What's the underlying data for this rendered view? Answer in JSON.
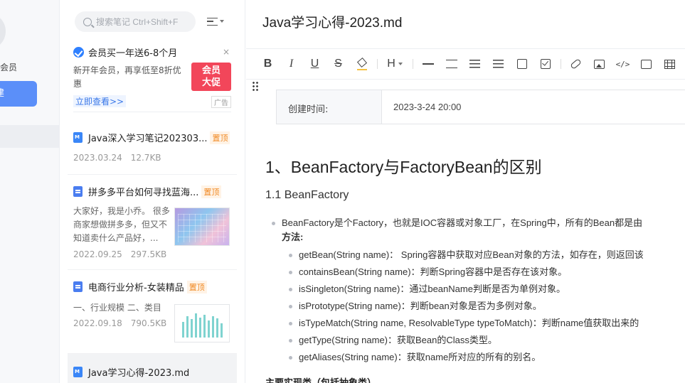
{
  "sidebar": {
    "member_label": "会员",
    "new_button_label": "建"
  },
  "search": {
    "placeholder": "搜索笔记 Ctrl+Shift+F"
  },
  "ad": {
    "title": "会员买一年送6-8个月",
    "close": "×",
    "desc": "新开年会员，再享低至8折优惠",
    "image_text": "会员\n大促",
    "link": "立即查看>>",
    "tag": "广告"
  },
  "notes": [
    {
      "icon": "md-file-icon",
      "title": "Java深入学习笔记202303...",
      "pin": "置顶",
      "date": "2023.03.24",
      "size": "12.7KB"
    },
    {
      "icon": "doc-file-icon",
      "title": "拼多多平台如何寻找蓝海...",
      "pin": "置顶",
      "excerpt": "大家好，我是小乔。 很多商家想做拼多多，但又不知道卖什么产品好，...",
      "date": "2022.09.25",
      "size": "297.5KB"
    },
    {
      "icon": "doc-file-icon",
      "title": "电商行业分析-女装精品",
      "pin": "置顶",
      "excerpt": "一、行业规模 二、类目",
      "date": "2022.09.18",
      "size": "790.5KB"
    },
    {
      "icon": "md-file-icon",
      "title": "Java学习心得-2023.md"
    }
  ],
  "editor": {
    "title": "Java学习心得-2023.md",
    "toolbar": {
      "bold": "B",
      "italic": "I",
      "underline": "U",
      "strike": "S",
      "heading": "H",
      "code": "</>"
    },
    "meta": {
      "key": "创建时间:",
      "value": "2023-3-24 20:00"
    },
    "h1": "1、BeanFactory与FactoryBean的区别",
    "h2": "1.1 BeanFactory",
    "bullet_main": "BeanFactory是个Factory，也就是IOC容器或对象工厂，在Spring中，所有的Bean都是由",
    "bullet_main_sub": "方法:",
    "methods": [
      "getBean(String name)： Spring容器中获取对应Bean对象的方法，如存在，则返回该",
      "containsBean(String name)：判断Spring容器中是否存在该对象。",
      "isSingleton(String name)：通过beanName判断是否为单例对象。",
      "isPrototype(String name)：判断bean对象是否为多例对象。",
      "isTypeMatch(String name, ResolvableType typeToMatch)：判断name值获取出来的",
      "getType(String name)：获取Bean的Class类型。",
      "getAliases(String name)：获取name所对应的所有的别名。"
    ],
    "next_heading": "主要实现类（包括抽象类）"
  }
}
